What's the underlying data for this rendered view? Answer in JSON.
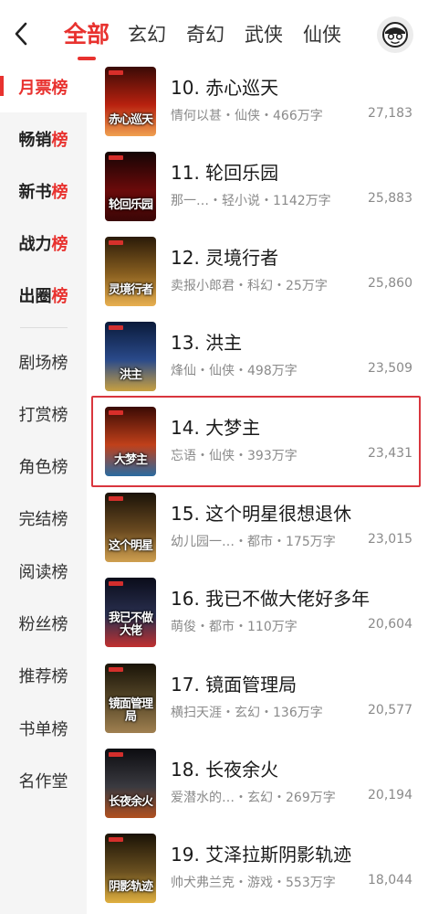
{
  "header": {
    "tabs": [
      {
        "label": "全部",
        "active": true
      },
      {
        "label": "玄幻",
        "active": false
      },
      {
        "label": "奇幻",
        "active": false
      },
      {
        "label": "武侠",
        "active": false
      },
      {
        "label": "仙侠",
        "active": false
      }
    ],
    "accent_color": "#e8322f"
  },
  "sidebar": {
    "items": [
      {
        "label": "月票",
        "label_hl": "榜",
        "active": true,
        "primary": true
      },
      {
        "label": "畅销",
        "label_hl": "榜",
        "active": false,
        "primary": true
      },
      {
        "label": "新书",
        "label_hl": "榜",
        "active": false,
        "primary": true
      },
      {
        "label": "战力",
        "label_hl": "榜",
        "active": false,
        "primary": true
      },
      {
        "label": "出圈",
        "label_hl": "榜",
        "active": false,
        "primary": true
      },
      {
        "label": "剧场榜",
        "active": false,
        "primary": false
      },
      {
        "label": "打赏榜",
        "active": false,
        "primary": false
      },
      {
        "label": "角色榜",
        "active": false,
        "primary": false
      },
      {
        "label": "完结榜",
        "active": false,
        "primary": false
      },
      {
        "label": "阅读榜",
        "active": false,
        "primary": false
      },
      {
        "label": "粉丝榜",
        "active": false,
        "primary": false
      },
      {
        "label": "推荐榜",
        "active": false,
        "primary": false
      },
      {
        "label": "书单榜",
        "active": false,
        "primary": false
      },
      {
        "label": "名作堂",
        "active": false,
        "primary": false
      }
    ]
  },
  "books": [
    {
      "title": "10. 赤心巡天",
      "meta": "情何以甚・仙侠・466万字",
      "count": "27,183",
      "cover_text": "赤心巡天",
      "cover_colors": [
        "#3a0a06",
        "#b8210f",
        "#f0a050"
      ]
    },
    {
      "title": "11. 轮回乐园",
      "meta": "那一…・轻小说・1142万字",
      "count": "25,883",
      "cover_text": "轮回乐园",
      "cover_colors": [
        "#140404",
        "#6a0a0a",
        "#3a0606"
      ]
    },
    {
      "title": "12. 灵境行者",
      "meta": "卖报小郎君・科幻・25万字",
      "count": "25,860",
      "cover_text": "灵境行者",
      "cover_colors": [
        "#2a1a08",
        "#8a6020",
        "#e8b050"
      ]
    },
    {
      "title": "13. 洪主",
      "meta": "烽仙・仙侠・498万字",
      "count": "23,509",
      "cover_text": "洪主",
      "cover_colors": [
        "#0a1a3a",
        "#2a4a8a",
        "#c8a040"
      ]
    },
    {
      "title": "14. 大梦主",
      "meta": "忘语・仙侠・393万字",
      "count": "23,431",
      "cover_text": "大梦主",
      "cover_colors": [
        "#3a0a04",
        "#c0401a",
        "#2a6aa0"
      ]
    },
    {
      "title": "15. 这个明星很想退休",
      "meta": "幼儿园一…・都市・175万字",
      "count": "23,015",
      "cover_text": "这个明星",
      "cover_colors": [
        "#1a1208",
        "#6a4a20",
        "#d0a050"
      ]
    },
    {
      "title": "16. 我已不做大佬好多年",
      "meta": "萌俊・都市・110万字",
      "count": "20,604",
      "cover_text": "我已不做大佬",
      "cover_colors": [
        "#0a0c1a",
        "#2a3050",
        "#c03030"
      ]
    },
    {
      "title": "17. 镜面管理局",
      "meta": "横扫天涯・玄幻・136万字",
      "count": "20,577",
      "cover_text": "镜面管理局",
      "cover_colors": [
        "#1a1408",
        "#5a4a2a",
        "#a08050"
      ]
    },
    {
      "title": "18. 长夜余火",
      "meta": "爱潜水的…・玄幻・269万字",
      "count": "20,194",
      "cover_text": "长夜余火",
      "cover_colors": [
        "#0c0c10",
        "#3a3a40",
        "#b05020"
      ]
    },
    {
      "title": "19. 艾泽拉斯阴影轨迹",
      "meta": "帅犬弗兰克・游戏・553万字",
      "count": "18,044",
      "cover_text": "阴影轨迹",
      "cover_colors": [
        "#1a1206",
        "#6a5020",
        "#e0b040"
      ]
    }
  ]
}
